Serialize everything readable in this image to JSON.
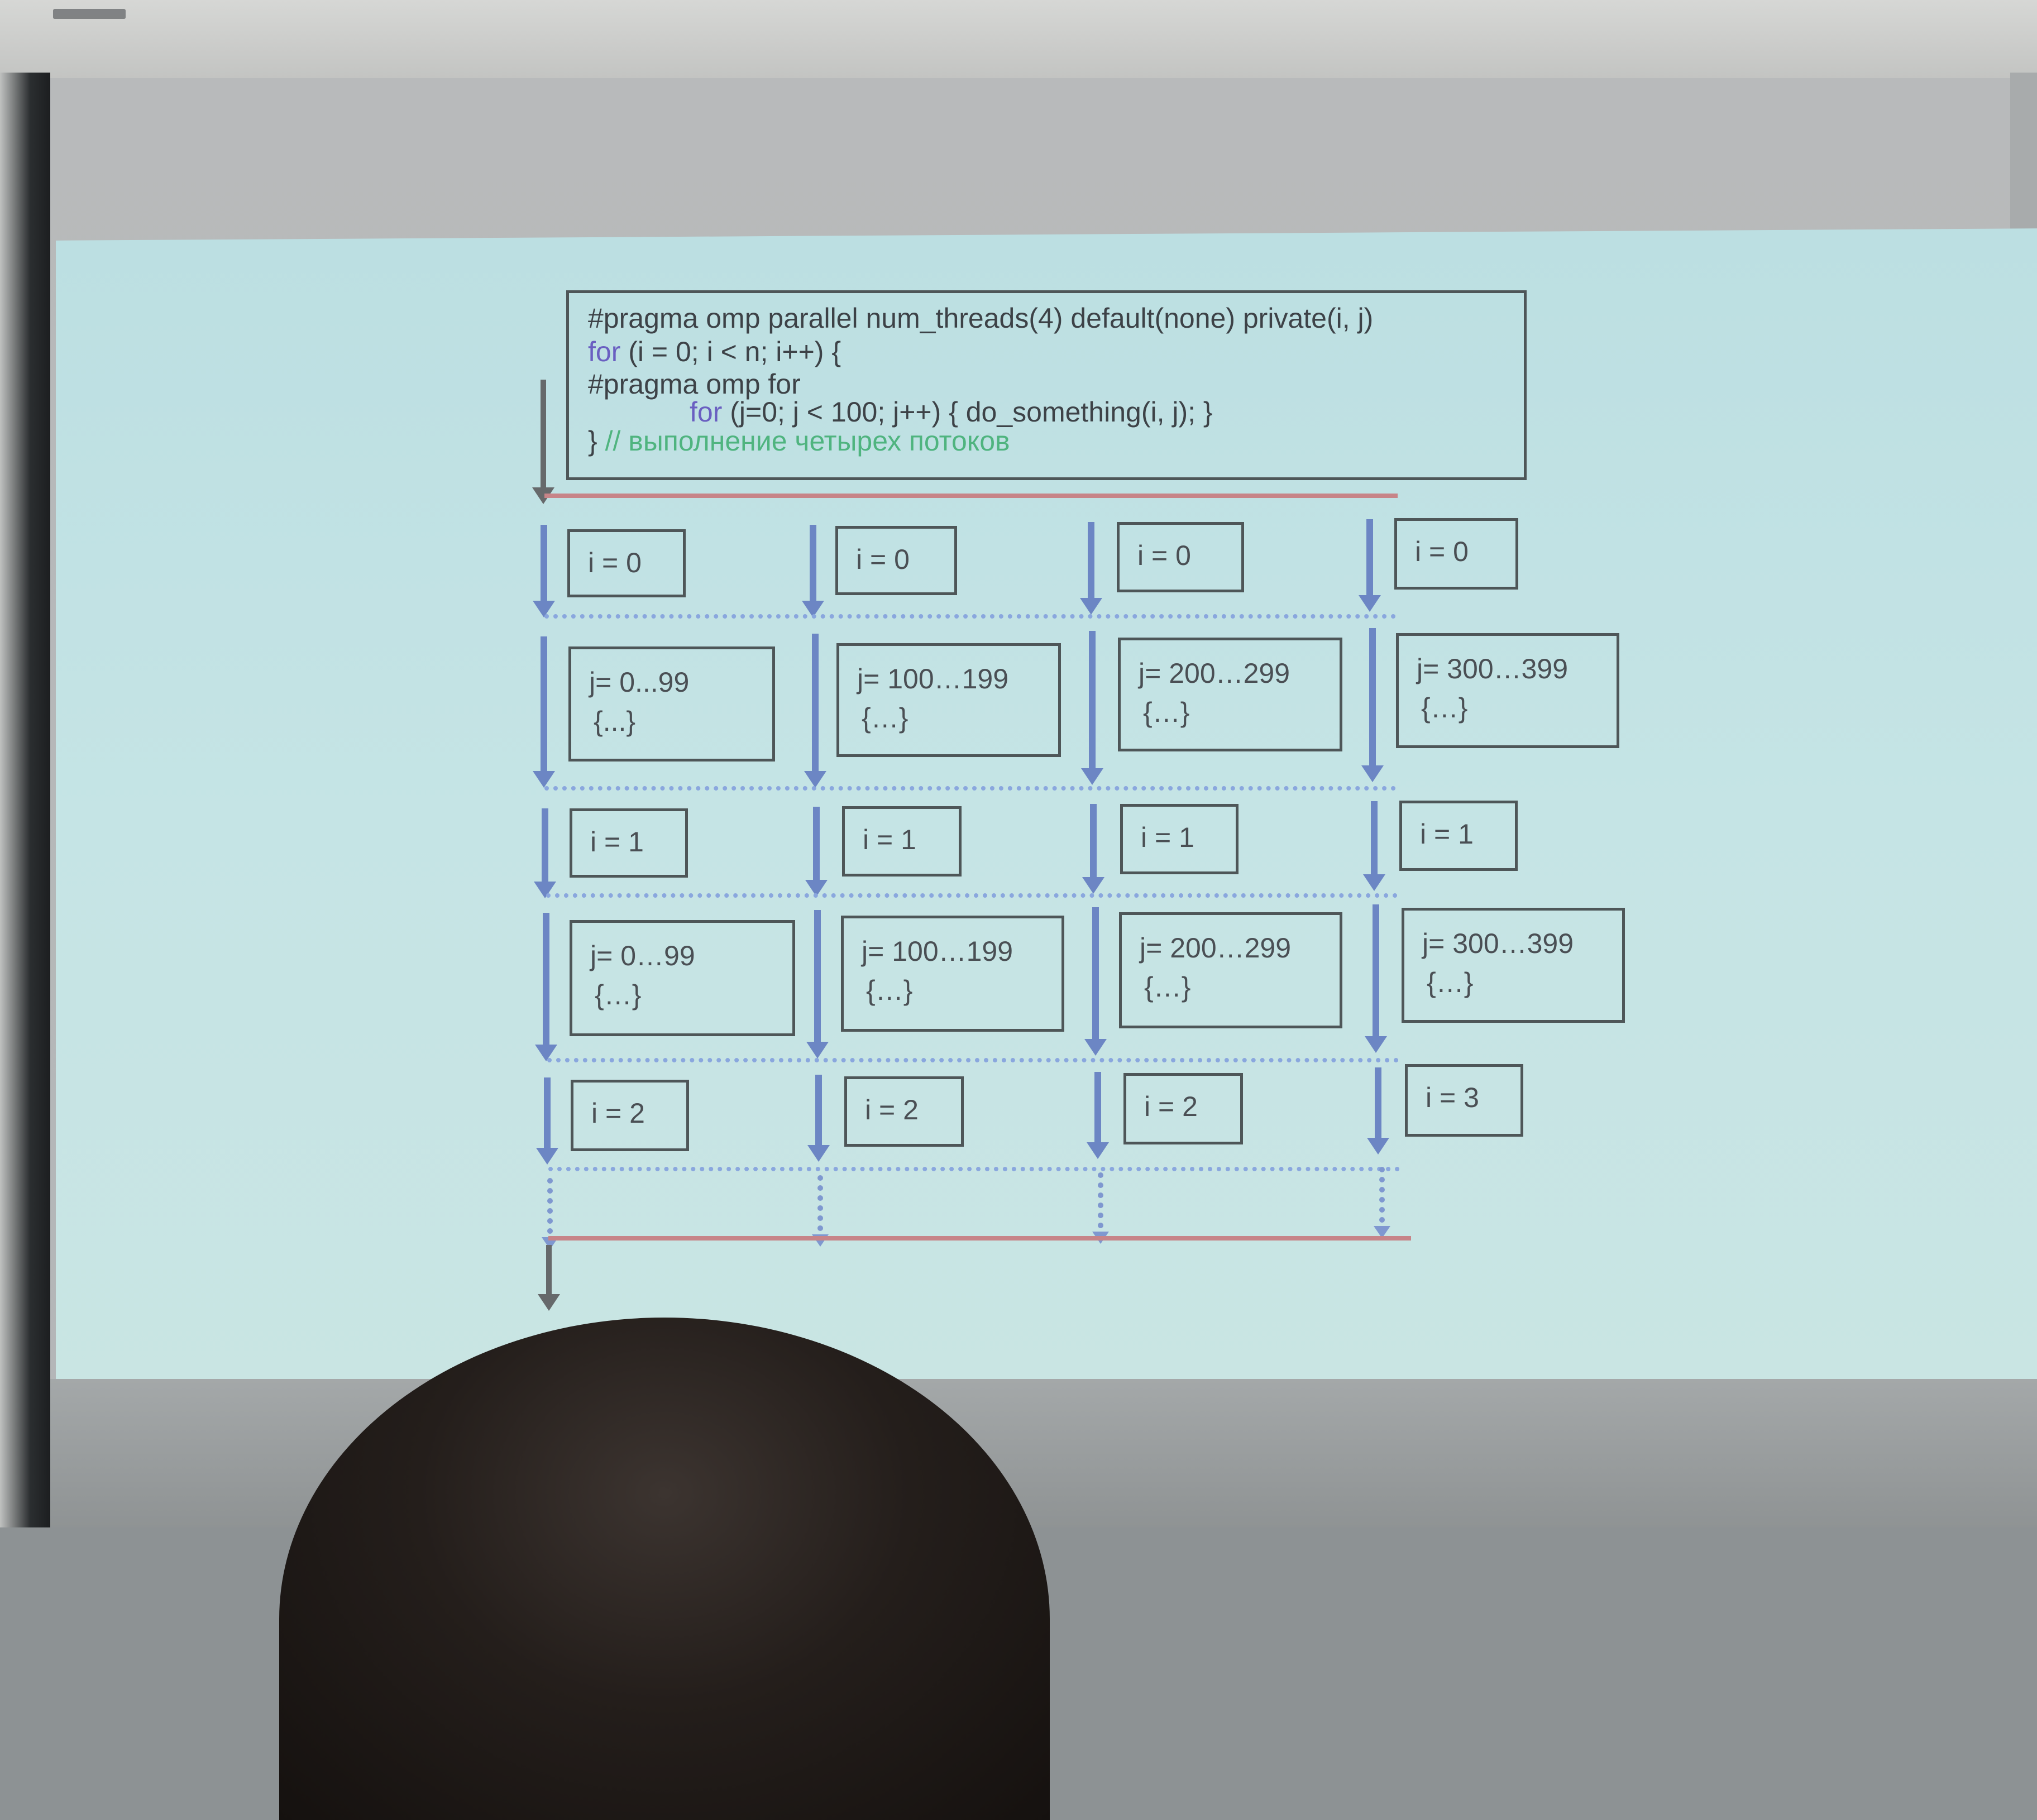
{
  "code": {
    "line1": "#pragma omp parallel num_threads(4) default(none) private(i, j)",
    "line2_kw": "for",
    "line2_rest": " (i = 0; i < n; i++) {",
    "line3": "#pragma omp for",
    "line4_kw": "for",
    "line4_rest": " (j=0; j < 100; j++) { do_something(i, j); }",
    "line5_brace": "}",
    "line5_comment": " // выполнение четырех потоков"
  },
  "grid": {
    "row1": [
      "i = 0",
      "i = 0",
      "i = 0",
      "i = 0"
    ],
    "row2": [
      {
        "range": "j= 0...99",
        "body": "{...}"
      },
      {
        "range": "j= 100…199",
        "body": "{…}"
      },
      {
        "range": "j= 200…299",
        "body": "{…}"
      },
      {
        "range": "j= 300…399",
        "body": "{…}"
      }
    ],
    "row3": [
      "i = 1",
      "i = 1",
      "i = 1",
      "i = 1"
    ],
    "row4": [
      {
        "range": "j= 0…99",
        "body": "{…}"
      },
      {
        "range": "j= 100…199",
        "body": "{…}"
      },
      {
        "range": "j= 200…299",
        "body": "{…}"
      },
      {
        "range": "j= 300…399",
        "body": "{…}"
      }
    ],
    "row5": [
      "i = 2",
      "i = 2",
      "i = 2",
      "i = 3"
    ]
  },
  "colors": {
    "thread_arrow": "#6c86c4",
    "barrier_line": "#c78488",
    "sync_dots": "#8aa7de",
    "keyword": "#6a5fc1",
    "comment": "#4fb47f"
  }
}
